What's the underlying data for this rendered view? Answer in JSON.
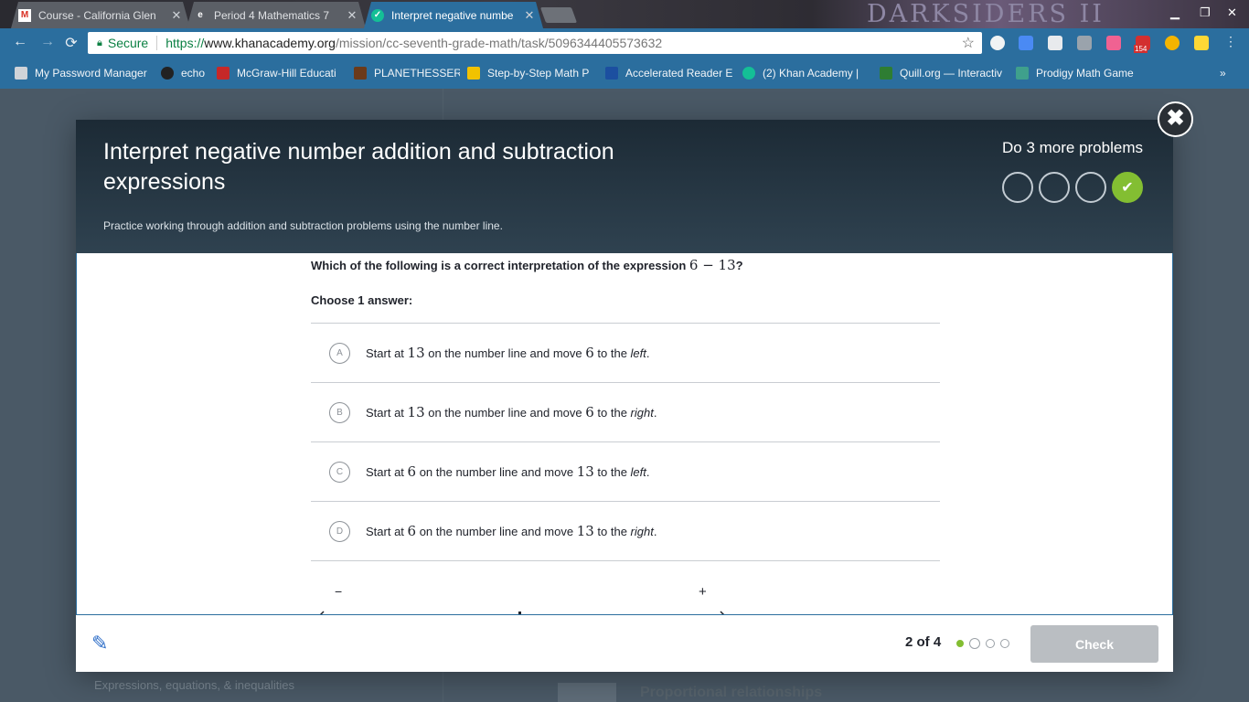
{
  "browser": {
    "tabs": [
      {
        "title": "Course - California Glen",
        "icon": "gmail-icon"
      },
      {
        "title": "Period 4 Mathematics 7",
        "icon": "edpuzzle-icon"
      },
      {
        "title": "Interpret negative numbe",
        "icon": "khan-academy-icon"
      }
    ],
    "brand": "DARKSIDERS II",
    "back": "←",
    "forward": "→",
    "reload": "⟳",
    "secure_label": "Secure",
    "url_protocol": "https://",
    "url_host": "www.khanacademy.org",
    "url_path": "/mission/cc-seventh-grade-math/task/5096344405573632",
    "extension_badge": "154",
    "bookmarks": [
      {
        "label": "My Password Manager",
        "color": "#cfd3d8"
      },
      {
        "label": "echo",
        "color": "#222222"
      },
      {
        "label": "McGraw-Hill Educati",
        "color": "#c62828"
      },
      {
        "label": "PLANETHESSER",
        "color": "#6b3a1a"
      },
      {
        "label": "Step-by-Step Math P",
        "color": "#f2c200"
      },
      {
        "label": "Accelerated Reader E",
        "color": "#1c4fa0"
      },
      {
        "label": "(2) Khan Academy |",
        "color": "#14bf96"
      },
      {
        "label": "Quill.org — Interactiv",
        "color": "#2e7d32"
      },
      {
        "label": "Prodigy Math Game",
        "color": "#3fa08c"
      }
    ],
    "more": "»"
  },
  "background_page": {
    "left_text": "Expressions, equations, & inequalities",
    "right_text": "Proportional relationships"
  },
  "modal": {
    "title": "Interpret negative number addition and subtraction expressions",
    "subtitle": "Practice working through addition and subtraction problems using the number line.",
    "remaining": "Do 3 more problems",
    "close": "✖",
    "question_prefix": "Which of the following is a correct interpretation of the expression ",
    "question_math": "6 − 13",
    "question_suffix": "?",
    "choose_label": "Choose 1 answer:",
    "choices": [
      {
        "letter": "A",
        "pre": "Start at ",
        "n1": "13",
        "mid": " on the number line and move ",
        "n2": "6",
        "to": " to the ",
        "dir": "left",
        "end": "."
      },
      {
        "letter": "B",
        "pre": "Start at ",
        "n1": "13",
        "mid": " on the number line and move ",
        "n2": "6",
        "to": " to the ",
        "dir": "right",
        "end": "."
      },
      {
        "letter": "C",
        "pre": "Start at ",
        "n1": "6",
        "mid": " on the number line and move ",
        "n2": "13",
        "to": " to the ",
        "dir": "left",
        "end": "."
      },
      {
        "letter": "D",
        "pre": "Start at ",
        "n1": "6",
        "mid": " on the number line and move ",
        "n2": "13",
        "to": " to the ",
        "dir": "right",
        "end": "."
      }
    ],
    "numline_minus": "−",
    "numline_plus": "+",
    "progress": "2 of 4",
    "check_label": "Check",
    "accent_green": "#83be32",
    "accent_blue": "#2b6e9e"
  }
}
